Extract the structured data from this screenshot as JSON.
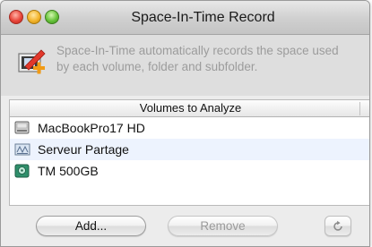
{
  "window": {
    "title": "Space-In-Time Record"
  },
  "info": {
    "text": "Space-In-Time automatically records the space used by each volume, folder and subfolder."
  },
  "list": {
    "header": "Volumes to Analyze",
    "items": [
      {
        "label": "MacBookPro17 HD",
        "icon": "hard-drive-icon"
      },
      {
        "label": "Serveur Partage",
        "icon": "network-share-icon"
      },
      {
        "label": "TM 500GB",
        "icon": "external-drive-icon"
      }
    ]
  },
  "buttons": {
    "add": "Add...",
    "remove": "Remove",
    "refresh_icon": "refresh-icon"
  }
}
